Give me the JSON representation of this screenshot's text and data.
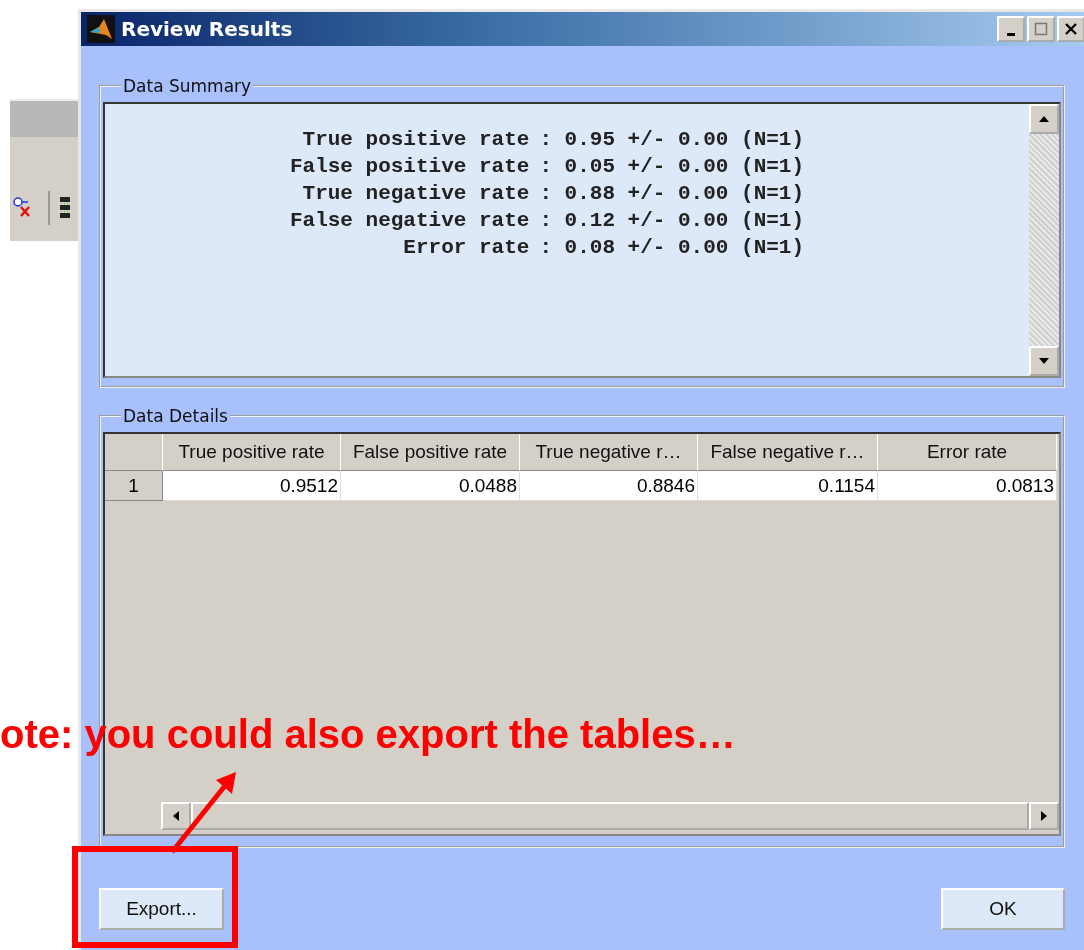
{
  "window": {
    "title": "Review Results"
  },
  "data_summary": {
    "title": "Data Summary",
    "lines": [
      {
        "label": "True positive rate",
        "value": ": 0.95 +/- 0.00 (N=1)"
      },
      {
        "label": "False positive rate",
        "value": ": 0.05 +/- 0.00 (N=1)"
      },
      {
        "label": "True negative rate",
        "value": ": 0.88 +/- 0.00 (N=1)"
      },
      {
        "label": "False negative rate",
        "value": ": 0.12 +/- 0.00 (N=1)"
      },
      {
        "label": "Error rate",
        "value": ": 0.08 +/- 0.00 (N=1)"
      }
    ]
  },
  "data_details": {
    "title": "Data Details",
    "columns": [
      "True positive rate",
      "False positive rate",
      "True negative r…",
      "False negative r…",
      "Error rate"
    ],
    "rows": [
      {
        "header": "1",
        "cells": [
          "0.9512",
          "0.0488",
          "0.8846",
          "0.1154",
          "0.0813"
        ]
      }
    ]
  },
  "buttons": [
    {
      "label": "Export...",
      "kind": "export"
    },
    {
      "label": "OK",
      "kind": "ok"
    }
  ],
  "annotation": {
    "note": "ote: you could also export the tables…"
  }
}
